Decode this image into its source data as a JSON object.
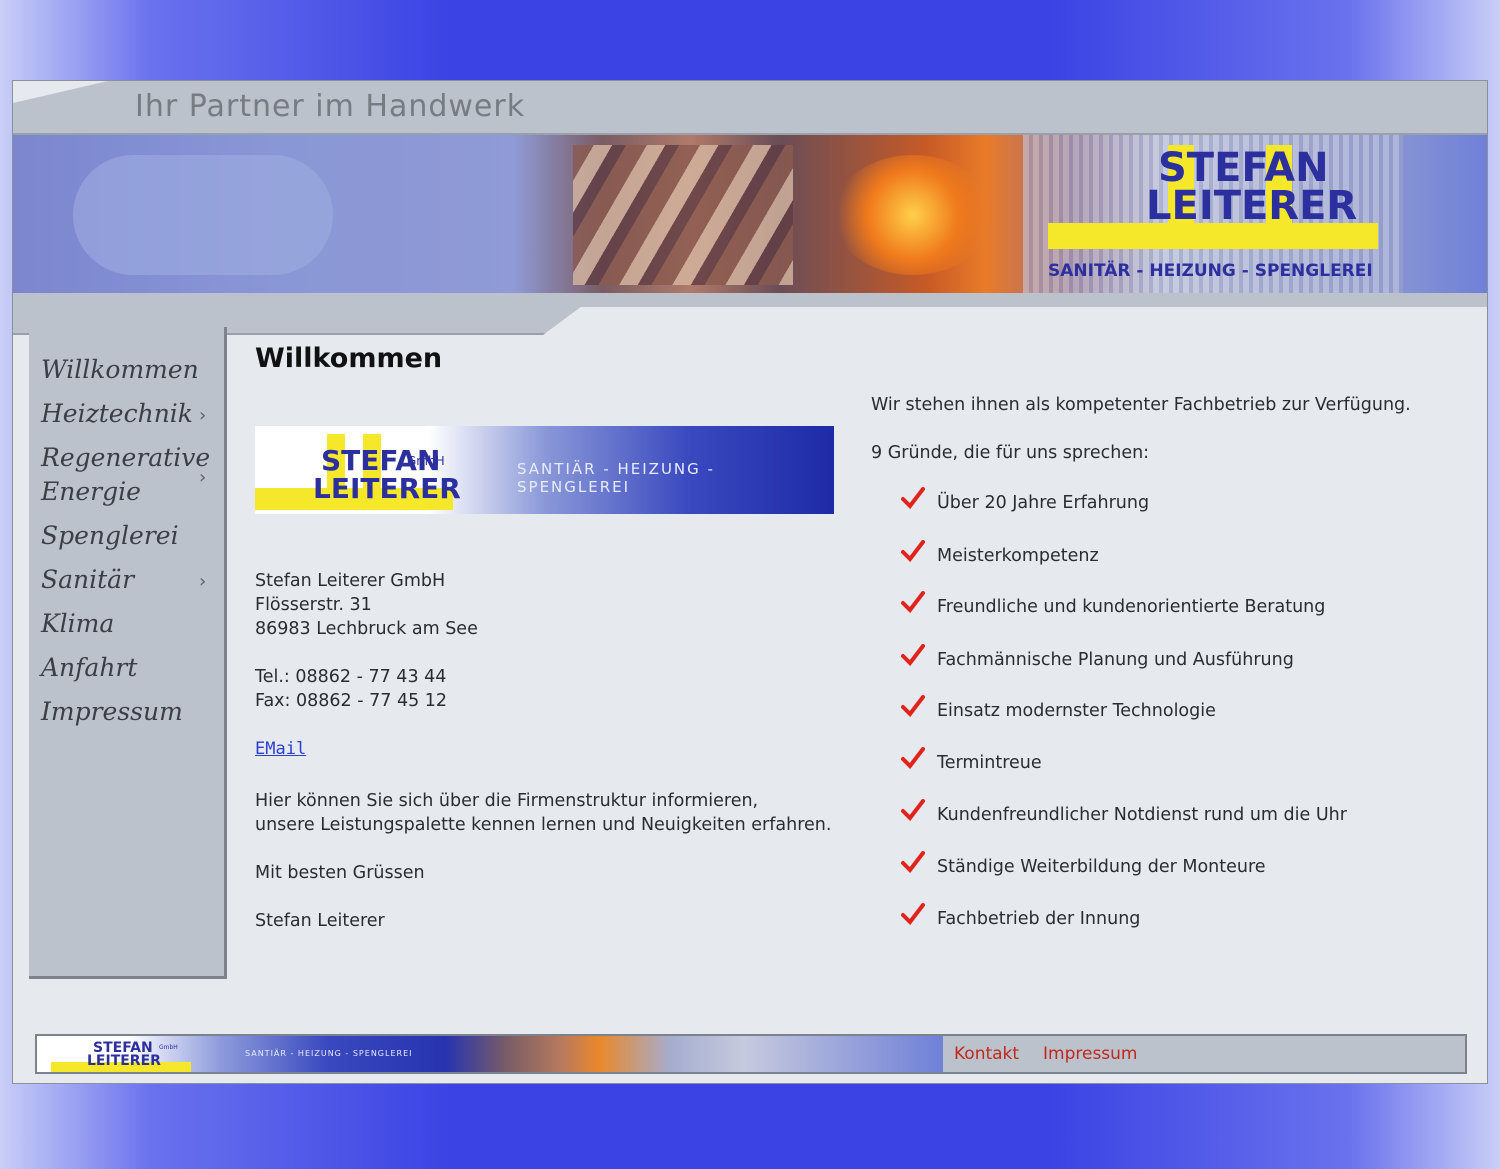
{
  "header": {
    "tagline": "Ihr Partner im Handwerk",
    "logo_top": "STEFAN",
    "logo_bottom": "LEITERER",
    "logo_services": "SANITÄR - HEIZUNG - SPENGLEREI"
  },
  "nav": {
    "items": [
      {
        "label": "Willkommen",
        "has_submenu": false
      },
      {
        "label": "Heiztechnik",
        "has_submenu": true
      },
      {
        "label": "Regenerative Energie",
        "has_submenu": true
      },
      {
        "label": "Spenglerei",
        "has_submenu": false
      },
      {
        "label": "Sanitär",
        "has_submenu": true
      },
      {
        "label": "Klima",
        "has_submenu": false
      },
      {
        "label": "Anfahrt",
        "has_submenu": false
      },
      {
        "label": "Impressum",
        "has_submenu": false
      }
    ],
    "arrow": "›"
  },
  "main": {
    "title": "Willkommen",
    "logo_strip": {
      "top": "STEFAN",
      "bottom": "LEITERER",
      "gmbh": "GmbH",
      "services": "SANTIÄR - HEIZUNG - SPENGLEREI"
    },
    "address": [
      "Stefan Leiterer GmbH",
      "Flösserstr. 31",
      "86983 Lechbruck am See"
    ],
    "contact": [
      "Tel.: 08862 - 77 43 44",
      "Fax: 08862 - 77 45 12"
    ],
    "email_label": "EMail",
    "paragraph": [
      "Hier können Sie sich über die Firmenstruktur informieren,",
      "unsere Leistungspalette kennen lernen und Neuigkeiten erfahren."
    ],
    "greeting": "Mit besten Grüssen",
    "signature": "Stefan Leiterer",
    "intro": "Wir stehen ihnen als kompetenter Fachbetrieb zur Verfügung.",
    "reasons_title": "9 Gründe, die für uns sprechen:",
    "reasons": [
      "Über 20 Jahre Erfahrung",
      "Meisterkompetenz",
      "Freundliche und kundenorientierte Beratung",
      "Fachmännische Planung und Ausführung",
      "Einsatz modernster Technologie",
      "Termintreue",
      "Kundenfreundlicher Notdienst rund um die Uhr",
      "Ständige Weiterbildung der Monteure",
      "Fachbetrieb der Innung"
    ]
  },
  "footer": {
    "logo_top": "STEFAN",
    "logo_bottom": "LEITERER",
    "gmbh": "GmbH",
    "services": "SANTIÄR - HEIZUNG - SPENGLEREI",
    "links": [
      "Kontakt",
      "Impressum"
    ]
  },
  "colors": {
    "accent_check": "#e0231b",
    "link_red": "#c0281c",
    "link_blue": "#2b3fcc",
    "logo_yellow": "#f5e82b",
    "logo_blue": "#2c2f9e"
  }
}
